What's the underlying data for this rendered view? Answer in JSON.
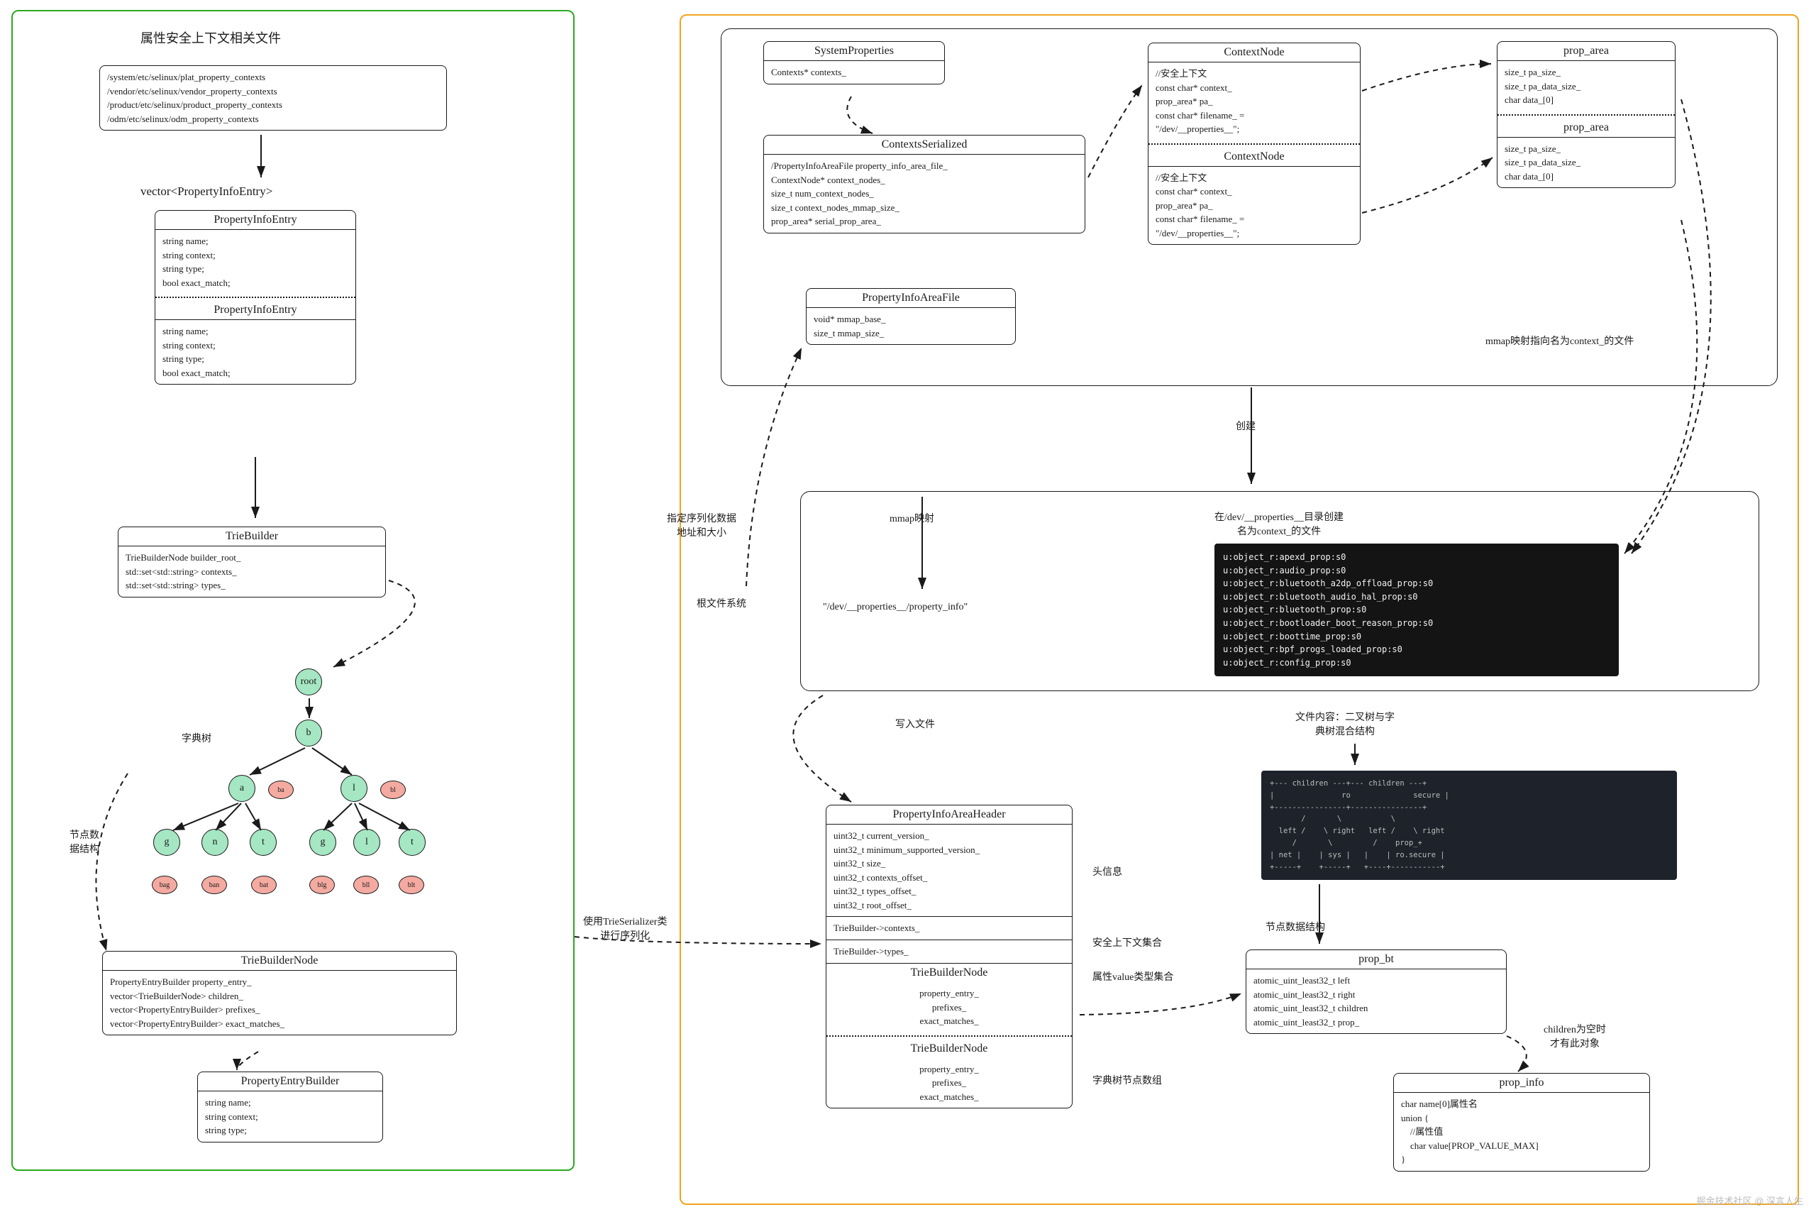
{
  "left": {
    "title": "属性安全上下文相关文件",
    "files": "/system/etc/selinux/plat_property_contexts\n/vendor/etc/selinux/vendor_property_contexts\n/product/etc/selinux/product_property_contexts\n/odm/etc/selinux/odm_property_contexts",
    "vector_label": "vector<PropertyInfoEntry>",
    "pie_title": "PropertyInfoEntry",
    "pie_body": "string name;\nstring context;\nstring type;\nbool exact_match;",
    "tb_title": "TrieBuilder",
    "tb_body": "TrieBuilderNode builder_root_\nstd::set<std::string> contexts_\nstd::set<std::string> types_",
    "tree_label": "字典树",
    "nodes": {
      "root": "root",
      "b": "b",
      "a": "a",
      "l": "l",
      "g": "g",
      "n": "n",
      "t": "t"
    },
    "leaves": {
      "ba": "ba",
      "bl": "bl",
      "bag": "bag",
      "ban": "ban",
      "bat": "bat",
      "blg": "blg",
      "bll": "bll",
      "blt": "blt"
    },
    "node_label": "节点数\n据结构",
    "tbn_title": "TrieBuilderNode",
    "tbn_body": "PropertyEntryBuilder property_entry_\nvector<TrieBuilderNode> children_\nvector<PropertyEntryBuilder> prefixes_\nvector<PropertyEntryBuilder> exact_matches_",
    "peb_title": "PropertyEntryBuilder",
    "peb_body": "string name;\nstring context;\nstring type;",
    "serialize_label": "使用TrieSerializer类\n进行序列化"
  },
  "right": {
    "sp_title": "SystemProperties",
    "sp_body": "Contexts* contexts_",
    "cs_title": "ContextsSerialized",
    "cs_body": "/PropertyInfoAreaFile property_info_area_file_\nContextNode* context_nodes_\nsize_t num_context_nodes_\nsize_t context_nodes_mmap_size_\nprop_area* serial_prop_area_",
    "piaf_title": "PropertyInfoAreaFile",
    "piaf_body": "void* mmap_base_\nsize_t mmap_size_",
    "cn_title": "ContextNode",
    "cn_body": "//安全上下文\nconst char* context_\nprop_area* pa_\nconst char* filename_ =\n\"/dev/__properties__\";",
    "pa_title": "prop_area",
    "pa_body": "size_t pa_size_\nsize_t pa_data_size_\nchar data_[0]",
    "mmap_file_label": "mmap映射指向名为context_的文件",
    "create_label": "创建",
    "mmap_label": "mmap映射",
    "addr_label": "指定序列化数据\n地址和大小",
    "rootfs_label": "根文件系统",
    "propinfo_path": "\"/dev/__properties__/property_info\"",
    "write_label": "写入文件",
    "devdir_label": "在/dev/__properties__目录创建\n名为context_的文件",
    "code_block": "u:object_r:apexd_prop:s0\nu:object_r:audio_prop:s0\nu:object_r:bluetooth_a2dp_offload_prop:s0\nu:object_r:bluetooth_audio_hal_prop:s0\nu:object_r:bluetooth_prop:s0\nu:object_r:bootloader_boot_reason_prop:s0\nu:object_r:boottime_prop:s0\nu:object_r:bpf_progs_loaded_prop:s0\nu:object_r:config_prop:s0",
    "content_label": "文件内容：二叉树与字\n典树混合结构",
    "piah_title": "PropertyInfoAreaHeader",
    "piah_body": "uint32_t current_version_\nuint32_t minimum_supported_version_\nuint32_t size_\nuint32_t contexts_offset_\nuint32_t types_offset_\nuint32_t root_offset_",
    "tb_ctx": "TrieBuilder->contexts_",
    "tb_types": "TrieBuilder->types_",
    "tbn_node": "TrieBuilderNode",
    "tbn_node_body": "property_entry_\nprefixes_\nexact_matches_",
    "hdr_label": "头信息",
    "ctx_set_label": "安全上下文集合",
    "type_set_label": "属性value类型集合",
    "trie_arr_label": "字典树节点数组",
    "node_ds_label": "节点数据结构",
    "pbt_title": "prop_bt",
    "pbt_body": "atomic_uint_least32_t left\natomic_uint_least32_t right\natomic_uint_least32_t children\natomic_uint_least32_t prop_",
    "pinfo_title": "prop_info",
    "pinfo_body": "char name[0]属性名\nunion {\n    //属性值\n    char value[PROP_VALUE_MAX]\n}",
    "children_label": "children为空时\n才有此对象",
    "tree_ascii": "+--- children ---+--- children ---+\n|               ro              secure |\n+----------------+----------------+\n       /       \\           \\\n  left /    \\ right   left /    \\ right\n     /       \\         /    prop_+\n| net |    | sys |   |    | ro.secure |\n+-----+    +-----+   +----+-----------+"
  },
  "watermark": "掘金技术社区 @ 深言人生"
}
